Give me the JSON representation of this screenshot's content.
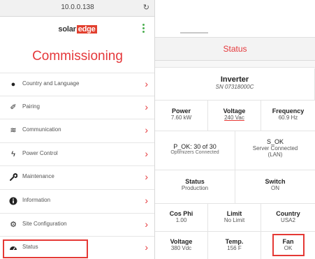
{
  "browser": {
    "url": "10.0.0.138"
  },
  "logo": {
    "left": "solar",
    "right": "edge"
  },
  "page_title": "Commissioning",
  "menu": [
    {
      "label": "Country and Language",
      "icon": "globe-icon",
      "glyph": "●"
    },
    {
      "label": "Pairing",
      "icon": "pairing-icon",
      "glyph": "✐"
    },
    {
      "label": "Communication",
      "icon": "wifi-icon",
      "glyph": "≋"
    },
    {
      "label": "Power Control",
      "icon": "lightning-icon",
      "glyph": "ϟ"
    },
    {
      "label": "Maintenance",
      "icon": "wrench-icon",
      "glyph": "🔧"
    },
    {
      "label": "Information",
      "icon": "info-icon",
      "glyph": "ℹ"
    },
    {
      "label": "Site Configuration",
      "icon": "gears-icon",
      "glyph": "⚙"
    },
    {
      "label": "Status",
      "icon": "dashboard-icon",
      "glyph": "◕"
    }
  ],
  "status": {
    "header": "Status",
    "inverter": {
      "title": "Inverter",
      "serial": "SN 07318000C"
    },
    "row1": [
      {
        "label": "Power",
        "value": "7.60 kW"
      },
      {
        "label": "Voltage",
        "value": "240 Vac"
      },
      {
        "label": "Frequency",
        "value": "60.9 Hz"
      }
    ],
    "row2": {
      "left_title": "P_OK: 30 of 30",
      "left_sub": "Optimizers Connected",
      "right_title": "S_OK",
      "right_sub1": "Server Connected",
      "right_sub2": "(LAN)"
    },
    "row3": [
      {
        "label": "Status",
        "value": "Production"
      },
      {
        "label": "Switch",
        "value": "ON"
      }
    ],
    "row4": [
      {
        "label": "Cos Phi",
        "value": "1.00"
      },
      {
        "label": "Limit",
        "value": "No Limit"
      },
      {
        "label": "Country",
        "value": "USA2"
      }
    ],
    "row5": [
      {
        "label": "Voltage",
        "value": "380 Vdc"
      },
      {
        "label": "Temp.",
        "value": "156 F"
      },
      {
        "label": "Fan",
        "value": "OK"
      }
    ]
  },
  "colors": {
    "accent": "#e5383b",
    "highlight": "#e53935",
    "logo_green": "#4caf50"
  }
}
